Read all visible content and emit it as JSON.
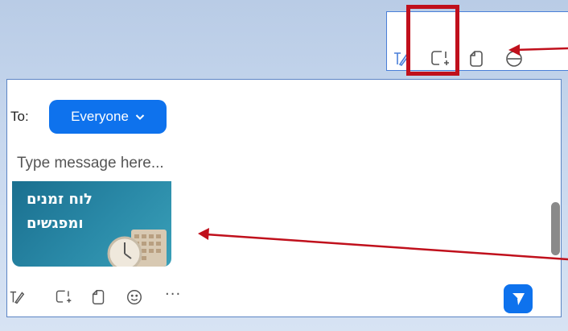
{
  "chat": {
    "to_label": "To:",
    "recipient": "Everyone",
    "message_placeholder": "Type message here...",
    "image_caption_line1": "לוח זמנים",
    "image_caption_line2": "ומפגשים",
    "more_label": "···"
  },
  "icons": {
    "top_toolbar": [
      "format-text-icon",
      "screenshot-icon",
      "file-icon",
      "reaction-icon"
    ],
    "bottom_toolbar": [
      "format-text-icon",
      "screenshot-icon",
      "file-icon",
      "emoji-icon",
      "more-icon",
      "send-icon"
    ]
  },
  "colors": {
    "accent": "#0e72ed",
    "highlight": "#c0101c",
    "panel_border": "#5b84c4"
  }
}
